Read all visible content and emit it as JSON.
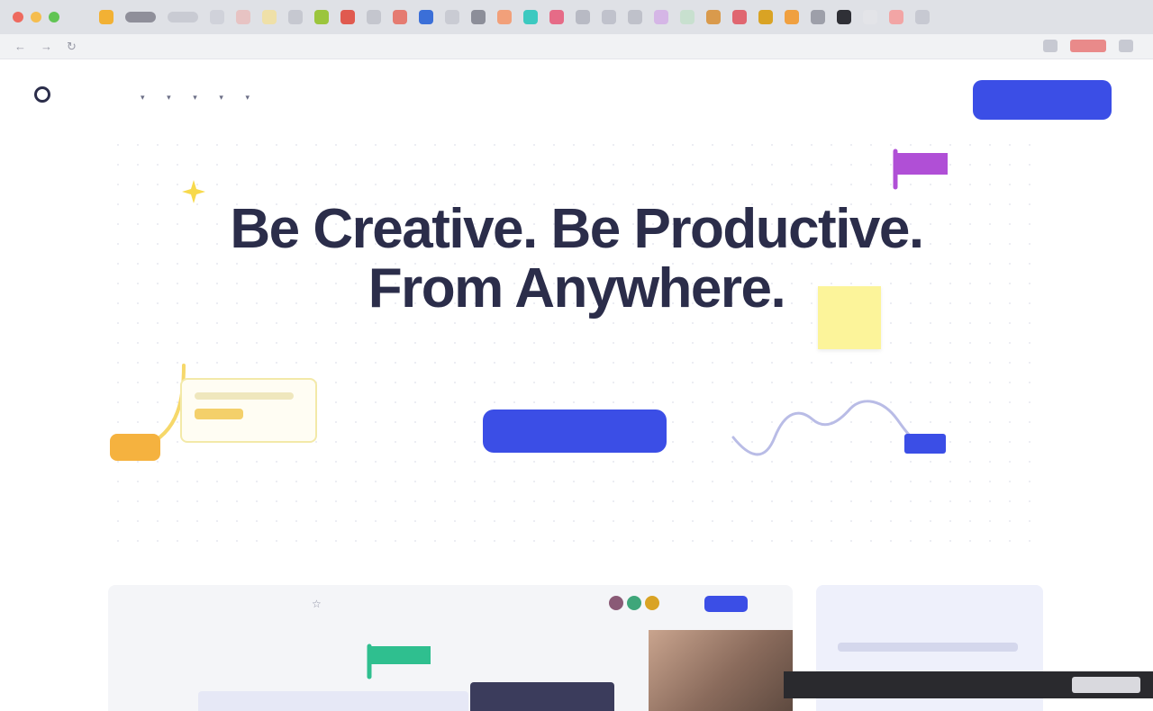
{
  "browser": {
    "traffic_colors": [
      "#ee6a5f",
      "#f5bd4f",
      "#61c454"
    ],
    "tab_favicon_colors": [
      "#f2b134",
      "#8f8f9a",
      "#c9cbd3",
      "#d0d2da",
      "#e7c3c3",
      "#efe0a8",
      "#c6c8d0",
      "#9bc53d",
      "#e05a4f",
      "#c4c6ce",
      "#e57b71",
      "#3b6fd8",
      "#c9cbd3",
      "#8c8e99",
      "#f2a07a",
      "#3cc9c0",
      "#e66b87",
      "#b8bac4",
      "#c0c2cc",
      "#bfc1ca",
      "#d5b6e6",
      "#c8e0cf",
      "#d99a4c",
      "#e06670",
      "#d9a324",
      "#f0a040",
      "#9d9fa9",
      "#2f3036",
      "#e3e4e8",
      "#f2a5a5",
      "#c7c9d2"
    ],
    "url": "",
    "nav_back": "←",
    "nav_forward": "→",
    "nav_reload": "↻"
  },
  "header": {
    "logo": "",
    "nav": [
      {
        "label": "",
        "icon": "chevron-down-icon"
      },
      {
        "label": "",
        "icon": "chevron-down-icon"
      },
      {
        "label": "",
        "icon": "chevron-down-icon"
      },
      {
        "label": "",
        "icon": "chevron-down-icon"
      },
      {
        "label": "",
        "icon": "chevron-down-icon"
      },
      {
        "label": "",
        "icon": ""
      }
    ],
    "login": "",
    "signup": ""
  },
  "hero": {
    "title_line1": "Be Creative. Be Productive.",
    "title_line2": "From Anywhere.",
    "subtitle": "",
    "cta": "",
    "note": ""
  },
  "preview": {
    "title": "",
    "breadcrumb": "",
    "share": ""
  },
  "sidecard": {
    "title": ""
  },
  "video": {
    "caption": "",
    "button": ""
  },
  "colors": {
    "accent": "#3b4ee6",
    "title": "#2b2d4a",
    "sticky": "#fcf49a",
    "purple_flag": "#b04fd6",
    "green_flag": "#2fbf8f"
  }
}
